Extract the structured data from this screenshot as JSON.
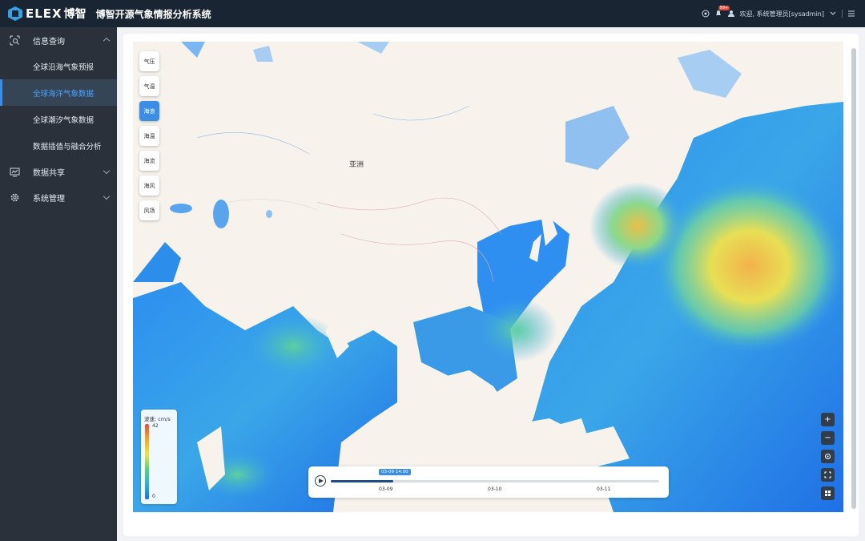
{
  "header": {
    "logo_text": "ELEX",
    "logo_cn": "博智",
    "app_title": "博智开源气象情报分析系统",
    "notification_badge": "99+",
    "welcome_text": "欢迎, 系统管理员[sysadmin]"
  },
  "sidebar": {
    "groups": [
      {
        "label": "信息查询",
        "icon": "search-doc-icon",
        "expanded": true,
        "items": [
          {
            "label": "全球沿海气象预报"
          },
          {
            "label": "全球海洋气象数据"
          },
          {
            "label": "全球潮汐气象数据"
          },
          {
            "label": "数据插值与融合分析"
          }
        ]
      },
      {
        "label": "数据共享",
        "icon": "chart-monitor-icon",
        "expanded": false
      },
      {
        "label": "系统管理",
        "icon": "gear-icon",
        "expanded": false
      }
    ],
    "active_item": "全球海洋气象数据"
  },
  "map": {
    "continent_label": "亚洲",
    "layers": [
      "气压",
      "气温",
      "海浪",
      "海温",
      "海流",
      "海风",
      "风场"
    ],
    "active_layer": "海浪"
  },
  "legend": {
    "title": "波速: cm/s",
    "max": "42",
    "min": "0"
  },
  "timeline": {
    "current_time": "03-09 14:00",
    "ticks": [
      "03-09",
      "03-10",
      "03-11"
    ],
    "progress": 0.19
  },
  "tools": [
    "zoom-in-icon",
    "zoom-out-icon",
    "locate-icon",
    "fullscreen-icon",
    "grid-icon"
  ],
  "colors": {
    "topbar": "#1a2533",
    "sidebar": "#2a313a",
    "accent": "#3a8ee6",
    "ocean_low": "#1e6fe8",
    "ocean_high": "#f5a623"
  }
}
